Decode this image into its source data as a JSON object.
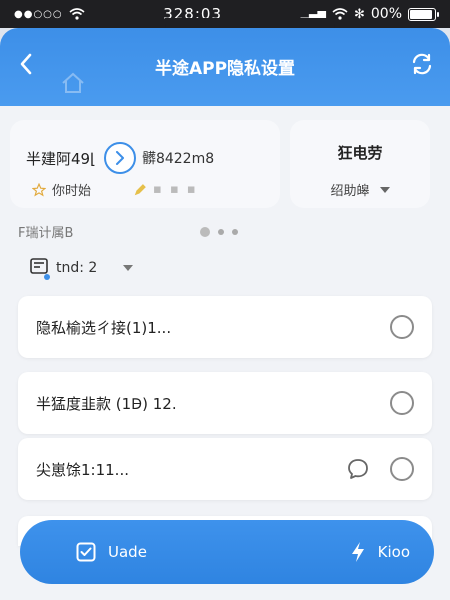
{
  "status_bar": {
    "signal": "●●○○○",
    "time": "328:03",
    "battery": "00%",
    "battery_level": 0.9
  },
  "header": {
    "title": "半途APP隐私设置"
  },
  "top_card": {
    "name": "半建阿49⌊",
    "code": "髒8422m8",
    "tag": "你时始",
    "faded_tag": "▪ ▪ ▪"
  },
  "side_card": {
    "title": "狂电劳",
    "select_value": "绍助皞"
  },
  "section": {
    "label": "F瑞计属B"
  },
  "filter": {
    "label": "tnd: 2"
  },
  "list": [
    {
      "text": "隐私榆选ㄔ接(1)1..."
    },
    {
      "text": "半猛度韭款 (1Ꟈ) 12."
    },
    {
      "text": "尖崽馀1:11..."
    }
  ],
  "bottom": {
    "left_label": "Uade",
    "right_label": "Kioo"
  },
  "colors": {
    "accent": "#3d8fe8",
    "status_bg": "#1f1f22"
  }
}
